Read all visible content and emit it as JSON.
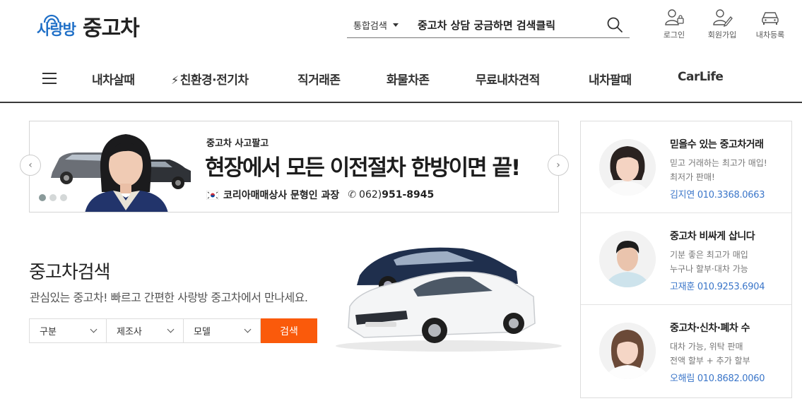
{
  "brand": {
    "name": "사랑방",
    "title": "중고차",
    "brand_color": "#1f6fc7"
  },
  "search": {
    "scope": "통합검색",
    "value": "중고차 상담 궁금하면 검색클릭",
    "button_icon": "search-icon"
  },
  "user_menu": [
    {
      "label": "로그인",
      "icon": "login-icon"
    },
    {
      "label": "회원가입",
      "icon": "signup-icon"
    },
    {
      "label": "내차등록",
      "icon": "car-register-icon"
    }
  ],
  "nav": {
    "menu_icon": "hamburger-icon",
    "items": [
      {
        "label": "내차살때"
      },
      {
        "label": "친환경·전기차",
        "icon": "lightning-icon"
      },
      {
        "label": "직거래존"
      },
      {
        "label": "화물차존"
      },
      {
        "label": "무료내차견적"
      },
      {
        "label": "내차팔때"
      },
      {
        "label": "CarLife"
      }
    ]
  },
  "banner": {
    "subtitle": "중고차 사고팔고",
    "headline": "현장에서 모든 이전절차 한방이면 끝!",
    "agent": "코리아매매상사 문형인 과장",
    "phone_prefix": "062)",
    "phone": "951-8945",
    "slides_total": 3,
    "slide_active": 1
  },
  "used_search": {
    "title": "중고차검색",
    "description": "관심있는 중고차! 빠르고 간편한 사랑방 중고차에서 만나세요.",
    "filters": [
      {
        "label": "구분"
      },
      {
        "label": "제조사"
      },
      {
        "label": "모델"
      }
    ],
    "submit": "검색",
    "accent": "#fa5a0b"
  },
  "dealers": [
    {
      "title": "믿을수 있는 중고차거래",
      "lines": [
        "믿고 거래하는 최고가 매입!",
        "최저가 판매!"
      ],
      "name": "김지연",
      "phone": "010.3368.0663"
    },
    {
      "title": "중고차 비싸게 삽니다",
      "lines": [
        "기분 좋은 최고가 매입",
        "누구나 할부·대차 가능"
      ],
      "name": "고재훈",
      "phone": "010.9253.6904"
    },
    {
      "title": "중고차·신차·폐차 수",
      "lines": [
        "대차 가능, 위탁 판매",
        "전액 할부 + 추가 할부"
      ],
      "name": "오해림",
      "phone": "010.8682.0060"
    }
  ]
}
